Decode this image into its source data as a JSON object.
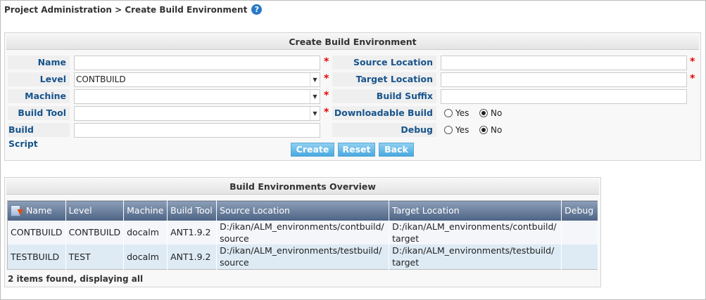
{
  "breadcrumb": "Project Administration > Create Build Environment",
  "help_icon": "?",
  "form": {
    "title": "Create Build Environment",
    "name_label": "Name",
    "name_value": "",
    "level_label": "Level",
    "level_value": "CONTBUILD",
    "machine_label": "Machine",
    "machine_value": "",
    "buildtool_label": "Build Tool",
    "buildtool_value": "",
    "buildscript_label": "Build Script",
    "buildscript_value": "",
    "source_label": "Source Location",
    "source_value": "",
    "target_label": "Target Location",
    "target_value": "",
    "suffix_label": "Build Suffix",
    "suffix_value": "",
    "downloadable_label": "Downloadable Build",
    "debug_label": "Debug",
    "yes": "Yes",
    "no": "No",
    "downloadable_selected": "No",
    "debug_selected": "No",
    "required": "*",
    "create": "Create",
    "reset": "Reset",
    "back": "Back"
  },
  "overview": {
    "title": "Build Environments Overview",
    "columns": [
      "Name",
      "Level",
      "Machine",
      "Build Tool",
      "Source Location",
      "Target Location",
      "Debug"
    ],
    "rows": [
      [
        "CONTBUILD",
        "CONTBUILD",
        "docalm",
        "ANT1.9.2",
        "D:/ikan/ALM_environments/contbuild/ source",
        "D:/ikan/ALM_environments/contbuild/ target",
        ""
      ],
      [
        "TESTBUILD",
        "TEST",
        "docalm",
        "ANT1.9.2",
        "D:/ikan/ALM_environments/testbuild/ source",
        "D:/ikan/ALM_environments/testbuild/ target",
        ""
      ]
    ],
    "footer": "2 items found, displaying all"
  },
  "colors": {
    "label": "#17548c",
    "button": "#4aa8de",
    "required": "#ee0000"
  }
}
